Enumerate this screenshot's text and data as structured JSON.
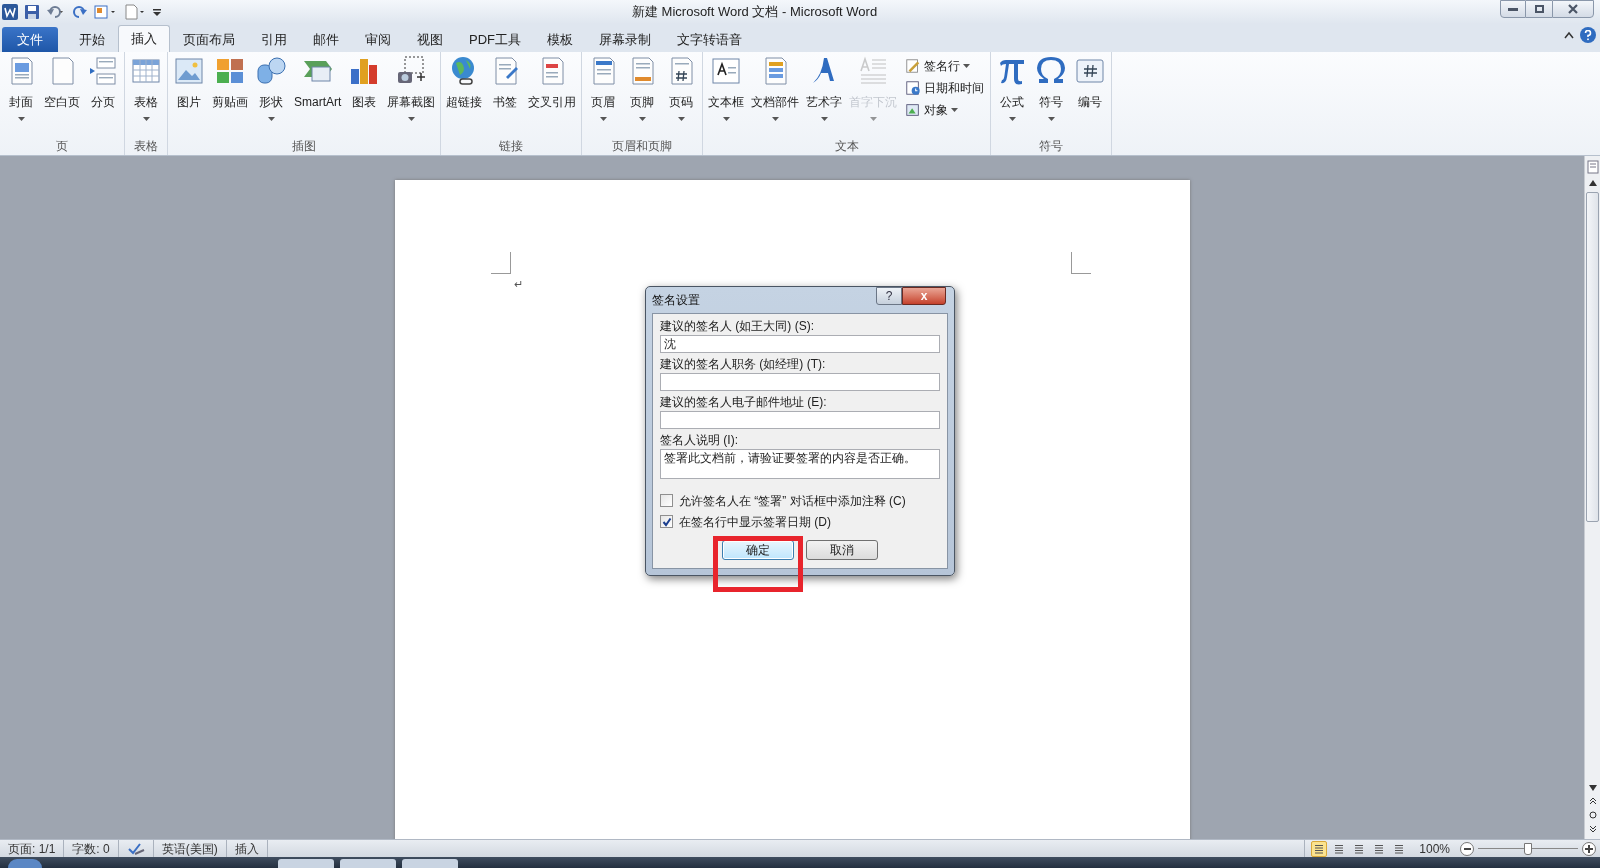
{
  "window": {
    "title": "新建 Microsoft Word 文档 - Microsoft Word"
  },
  "tabs": [
    {
      "label": "文件",
      "kind": "file",
      "selected": false
    },
    {
      "label": "开始",
      "kind": "tab",
      "selected": false
    },
    {
      "label": "插入",
      "kind": "tab",
      "selected": true
    },
    {
      "label": "页面布局",
      "kind": "tab",
      "selected": false
    },
    {
      "label": "引用",
      "kind": "tab",
      "selected": false
    },
    {
      "label": "邮件",
      "kind": "tab",
      "selected": false
    },
    {
      "label": "审阅",
      "kind": "tab",
      "selected": false
    },
    {
      "label": "视图",
      "kind": "tab",
      "selected": false
    },
    {
      "label": "PDF工具",
      "kind": "tab",
      "selected": false
    },
    {
      "label": "模板",
      "kind": "tab",
      "selected": false
    },
    {
      "label": "屏幕录制",
      "kind": "tab",
      "selected": false
    },
    {
      "label": "文字转语音",
      "kind": "tab",
      "selected": false
    }
  ],
  "ribbon_groups": [
    {
      "label": "页",
      "items": [
        {
          "label": "封面",
          "kind": "large",
          "dropdown": true,
          "disabled": false
        },
        {
          "label": "空白页",
          "kind": "large",
          "dropdown": false,
          "disabled": false
        },
        {
          "label": "分页",
          "kind": "large",
          "dropdown": false,
          "disabled": false
        }
      ]
    },
    {
      "label": "表格",
      "items": [
        {
          "label": "表格",
          "kind": "large",
          "dropdown": true,
          "disabled": false
        }
      ]
    },
    {
      "label": "插图",
      "items": [
        {
          "label": "图片",
          "kind": "large",
          "dropdown": false,
          "disabled": false
        },
        {
          "label": "剪贴画",
          "kind": "large",
          "dropdown": false,
          "disabled": false
        },
        {
          "label": "形状",
          "kind": "large",
          "dropdown": true,
          "disabled": false
        },
        {
          "label": "SmartArt",
          "kind": "large",
          "dropdown": false,
          "disabled": false
        },
        {
          "label": "图表",
          "kind": "large",
          "dropdown": false,
          "disabled": false
        },
        {
          "label": "屏幕截图",
          "kind": "large",
          "dropdown": true,
          "disabled": false
        }
      ]
    },
    {
      "label": "链接",
      "items": [
        {
          "label": "超链接",
          "kind": "large",
          "dropdown": false,
          "disabled": false
        },
        {
          "label": "书签",
          "kind": "large",
          "dropdown": false,
          "disabled": false
        },
        {
          "label": "交叉引用",
          "kind": "large",
          "dropdown": false,
          "disabled": false
        }
      ]
    },
    {
      "label": "页眉和页脚",
      "items": [
        {
          "label": "页眉",
          "kind": "large",
          "dropdown": true,
          "disabled": false
        },
        {
          "label": "页脚",
          "kind": "large",
          "dropdown": true,
          "disabled": false
        },
        {
          "label": "页码",
          "kind": "large",
          "dropdown": true,
          "disabled": false
        }
      ]
    },
    {
      "label": "文本",
      "items": [
        {
          "label": "文本框",
          "kind": "large",
          "dropdown": true,
          "disabled": false
        },
        {
          "label": "文档部件",
          "kind": "large",
          "dropdown": true,
          "disabled": false
        },
        {
          "label": "艺术字",
          "kind": "large",
          "dropdown": true,
          "disabled": false
        },
        {
          "label": "首字下沉",
          "kind": "large",
          "dropdown": true,
          "disabled": true
        },
        {
          "label": "签名行",
          "kind": "small",
          "dropdown": true,
          "disabled": false
        },
        {
          "label": "日期和时间",
          "kind": "small",
          "dropdown": false,
          "disabled": false
        },
        {
          "label": "对象",
          "kind": "small",
          "dropdown": true,
          "disabled": false
        }
      ]
    },
    {
      "label": "符号",
      "items": [
        {
          "label": "公式",
          "kind": "large",
          "dropdown": true,
          "disabled": false
        },
        {
          "label": "符号",
          "kind": "large",
          "dropdown": true,
          "disabled": false
        },
        {
          "label": "编号",
          "kind": "large",
          "dropdown": false,
          "disabled": false
        }
      ]
    }
  ],
  "document": {
    "paragraph_mark": "↵"
  },
  "dialog": {
    "title": "签名设置",
    "help": "?",
    "close": "x",
    "fields": [
      {
        "label": "建议的签名人 (如王大同) (S):",
        "value": "沈",
        "kind": "line"
      },
      {
        "label": "建议的签名人职务 (如经理) (T):",
        "kind": "line"
      },
      {
        "label": "建议的签名人电子邮件地址 (E):",
        "kind": "line"
      },
      {
        "label": "签名人说明 (I):",
        "value": "签署此文档前，请验证要签署的内容是否正确。",
        "kind": "area"
      }
    ],
    "checkboxes": [
      {
        "label": "允许签名人在 “签署” 对话框中添加注释 (C)",
        "checked": false
      },
      {
        "label": "在签名行中显示签署日期 (D)",
        "checked": true
      }
    ],
    "buttons": [
      {
        "label": "确定",
        "selected": true
      },
      {
        "label": "取消",
        "selected": false
      }
    ]
  },
  "status_bar": {
    "items": [
      "页面: 1/1",
      "字数: 0",
      "英语(美国)",
      "插入"
    ],
    "views": [
      {
        "selected": true
      },
      {
        "selected": false
      },
      {
        "selected": false
      },
      {
        "selected": false
      },
      {
        "selected": false
      }
    ],
    "zoom": "100%",
    "zoom_slider": {
      "level": 0.5
    }
  }
}
